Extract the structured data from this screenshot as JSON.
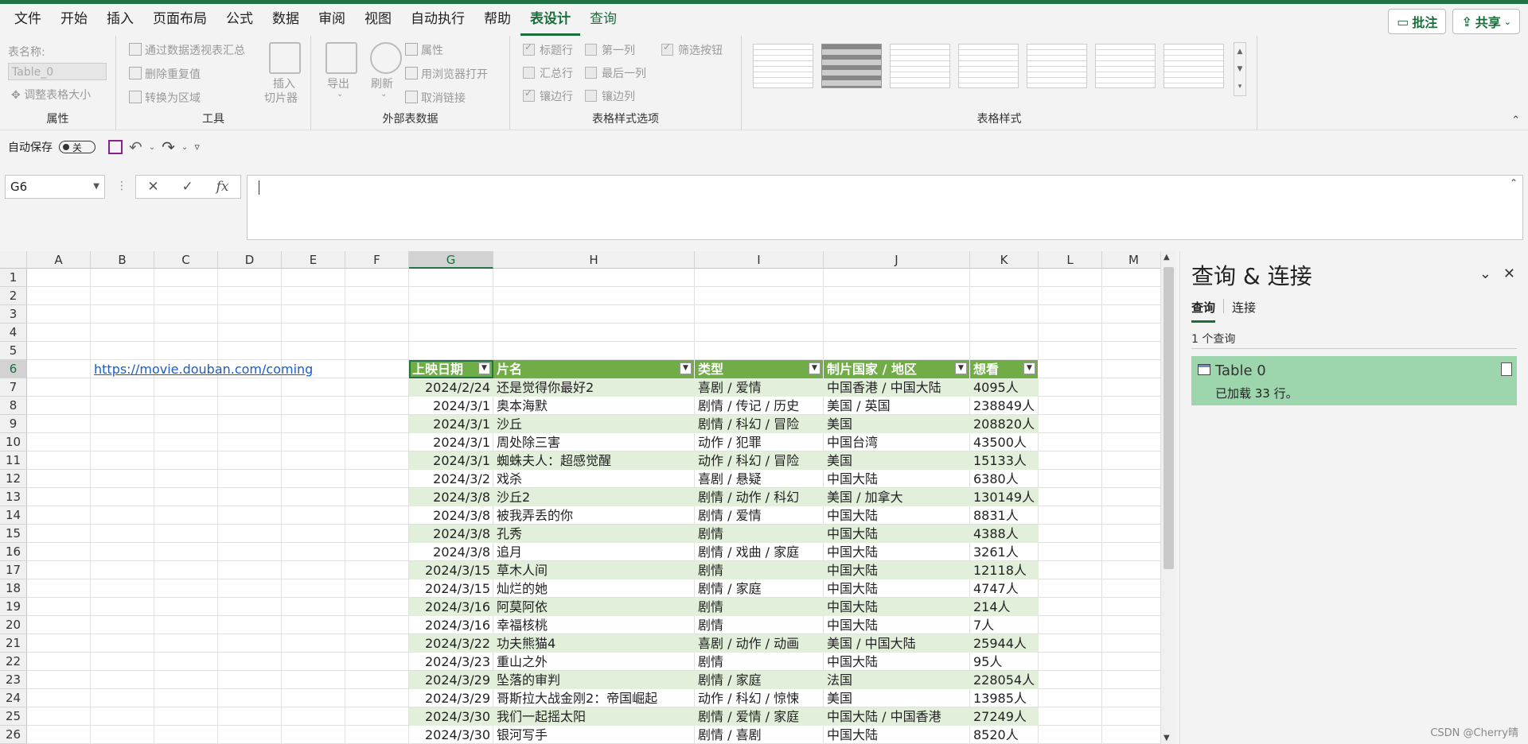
{
  "menu": {
    "items": [
      "文件",
      "开始",
      "插入",
      "页面布局",
      "公式",
      "数据",
      "审阅",
      "视图",
      "自动执行",
      "帮助",
      "表设计",
      "查询"
    ],
    "active": "表设计",
    "comment_label": "批注",
    "share_label": "共享"
  },
  "ribbon": {
    "properties": {
      "label": "属性",
      "table_name_label": "表名称:",
      "table_name_value": "Table_0",
      "resize_label": "调整表格大小"
    },
    "tools": {
      "label": "工具",
      "pivot_label": "通过数据透视表汇总",
      "remove_dup_label": "删除重复值",
      "convert_label": "转换为区域",
      "slicer_label_1": "插入",
      "slicer_label_2": "切片器"
    },
    "external": {
      "label": "外部表数据",
      "export_label": "导出",
      "refresh_label": "刷新",
      "props_label": "属性",
      "browser_label": "用浏览器打开",
      "unlink_label": "取消链接"
    },
    "style_options": {
      "label": "表格样式选项",
      "header_row": "标题行",
      "first_col": "第一列",
      "filter_btn": "筛选按钮",
      "total_row": "汇总行",
      "last_col": "最后一列",
      "banded_rows": "镶边行",
      "banded_cols": "镶边列"
    },
    "styles": {
      "label": "表格样式"
    }
  },
  "qat": {
    "autosave_label": "自动保存",
    "autosave_state": "关"
  },
  "formula_bar": {
    "namebox": "G6",
    "fx": "fx",
    "content": ""
  },
  "columns": [
    "A",
    "B",
    "C",
    "D",
    "E",
    "F",
    "G",
    "H",
    "I",
    "J",
    "K",
    "L",
    "M"
  ],
  "rows": [
    "1",
    "2",
    "3",
    "4",
    "5",
    "6",
    "7",
    "8",
    "9",
    "10",
    "11",
    "12",
    "13",
    "14",
    "15",
    "16",
    "17",
    "18",
    "19",
    "20",
    "21",
    "22",
    "23",
    "24",
    "25",
    "26"
  ],
  "link_cell": "https://movie.douban.com/coming",
  "table": {
    "headers": [
      "上映日期",
      "片名",
      "类型",
      "制片国家 / 地区",
      "想看"
    ],
    "rows": [
      [
        "2024/2/24",
        "还是觉得你最好2",
        "喜剧 / 爱情",
        "中国香港 / 中国大陆",
        "4095人"
      ],
      [
        "2024/3/1",
        "奥本海默",
        "剧情 / 传记 / 历史",
        "美国 / 英国",
        "238849人"
      ],
      [
        "2024/3/1",
        "沙丘",
        "剧情 / 科幻 / 冒险",
        "美国",
        "208820人"
      ],
      [
        "2024/3/1",
        "周处除三害",
        "动作 / 犯罪",
        "中国台湾",
        "43500人"
      ],
      [
        "2024/3/1",
        "蜘蛛夫人：超感觉醒",
        "动作 / 科幻 / 冒险",
        "美国",
        "15133人"
      ],
      [
        "2024/3/2",
        "戏杀",
        "喜剧 / 悬疑",
        "中国大陆",
        "6380人"
      ],
      [
        "2024/3/8",
        "沙丘2",
        "剧情 / 动作 / 科幻",
        "美国 / 加拿大",
        "130149人"
      ],
      [
        "2024/3/8",
        "被我弄丢的你",
        "剧情 / 爱情",
        "中国大陆",
        "8831人"
      ],
      [
        "2024/3/8",
        "孔秀",
        "剧情",
        "中国大陆",
        "4388人"
      ],
      [
        "2024/3/8",
        "追月",
        "剧情 / 戏曲 / 家庭",
        "中国大陆",
        "3261人"
      ],
      [
        "2024/3/15",
        "草木人间",
        "剧情",
        "中国大陆",
        "12118人"
      ],
      [
        "2024/3/15",
        "灿烂的她",
        "剧情 / 家庭",
        "中国大陆",
        "4747人"
      ],
      [
        "2024/3/16",
        "阿莫阿依",
        "剧情",
        "中国大陆",
        "214人"
      ],
      [
        "2024/3/16",
        "幸福核桃",
        "剧情",
        "中国大陆",
        "7人"
      ],
      [
        "2024/3/22",
        "功夫熊猫4",
        "喜剧 / 动作 / 动画",
        "美国 / 中国大陆",
        "25944人"
      ],
      [
        "2024/3/23",
        "重山之外",
        "剧情",
        "中国大陆",
        "95人"
      ],
      [
        "2024/3/29",
        "坠落的审判",
        "剧情 / 家庭",
        "法国",
        "228054人"
      ],
      [
        "2024/3/29",
        "哥斯拉大战金刚2：帝国崛起",
        "动作 / 科幻 / 惊悚",
        "美国",
        "13985人"
      ],
      [
        "2024/3/30",
        "我们一起摇太阳",
        "剧情 / 爱情 / 家庭",
        "中国大陆 / 中国香港",
        "27249人"
      ],
      [
        "2024/3/30",
        "银河写手",
        "剧情 / 喜剧",
        "中国大陆",
        "8520人"
      ]
    ]
  },
  "panel": {
    "title": "查询 & 连接",
    "tab_queries": "查询",
    "tab_connections": "连接",
    "count": "1 个查询",
    "query_name": "Table 0",
    "query_status": "已加载 33 行。"
  },
  "watermark": "CSDN @Cherry晴",
  "colors": {
    "accent": "#217346",
    "table_header": "#70ad47",
    "band": "#e2efda",
    "query_card": "#9dd6ad"
  }
}
